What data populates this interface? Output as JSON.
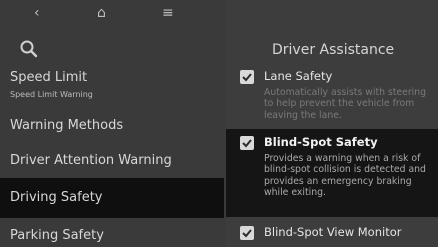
{
  "nav": {
    "back_icon": "chevron-left-icon",
    "home_icon": "home-icon",
    "menu_icon": "menu-icon",
    "back_glyph": "‹",
    "home_glyph": "⌂",
    "menu_glyph": "≡"
  },
  "left_menu": {
    "search_icon": "search-icon",
    "items": [
      {
        "label": "Speed Limit",
        "sublabel": "Speed Limit Warning"
      },
      {
        "label": "Warning Methods"
      },
      {
        "label": "Driver Attention Warning"
      },
      {
        "label": "Driving Safety",
        "selected": true
      },
      {
        "label": "Parking Safety"
      }
    ]
  },
  "right_panel": {
    "title": "Driver Assistance",
    "options": [
      {
        "label": "Lane Safety",
        "checked": true,
        "description": "Automatically assists with steering to help prevent the vehicle from leaving the lane."
      },
      {
        "label": "Blind-Spot Safety",
        "checked": true,
        "highlighted": true,
        "description": "Provides a warning when a risk of blind-spot collision is detected and provides an emergency braking while exiting."
      },
      {
        "label": "Blind-Spot View Monitor",
        "checked": true
      }
    ]
  },
  "colors": {
    "background": "#3d3d3d",
    "selected_item": "#0f0f0f",
    "checkbox": "#d9d9d9"
  }
}
